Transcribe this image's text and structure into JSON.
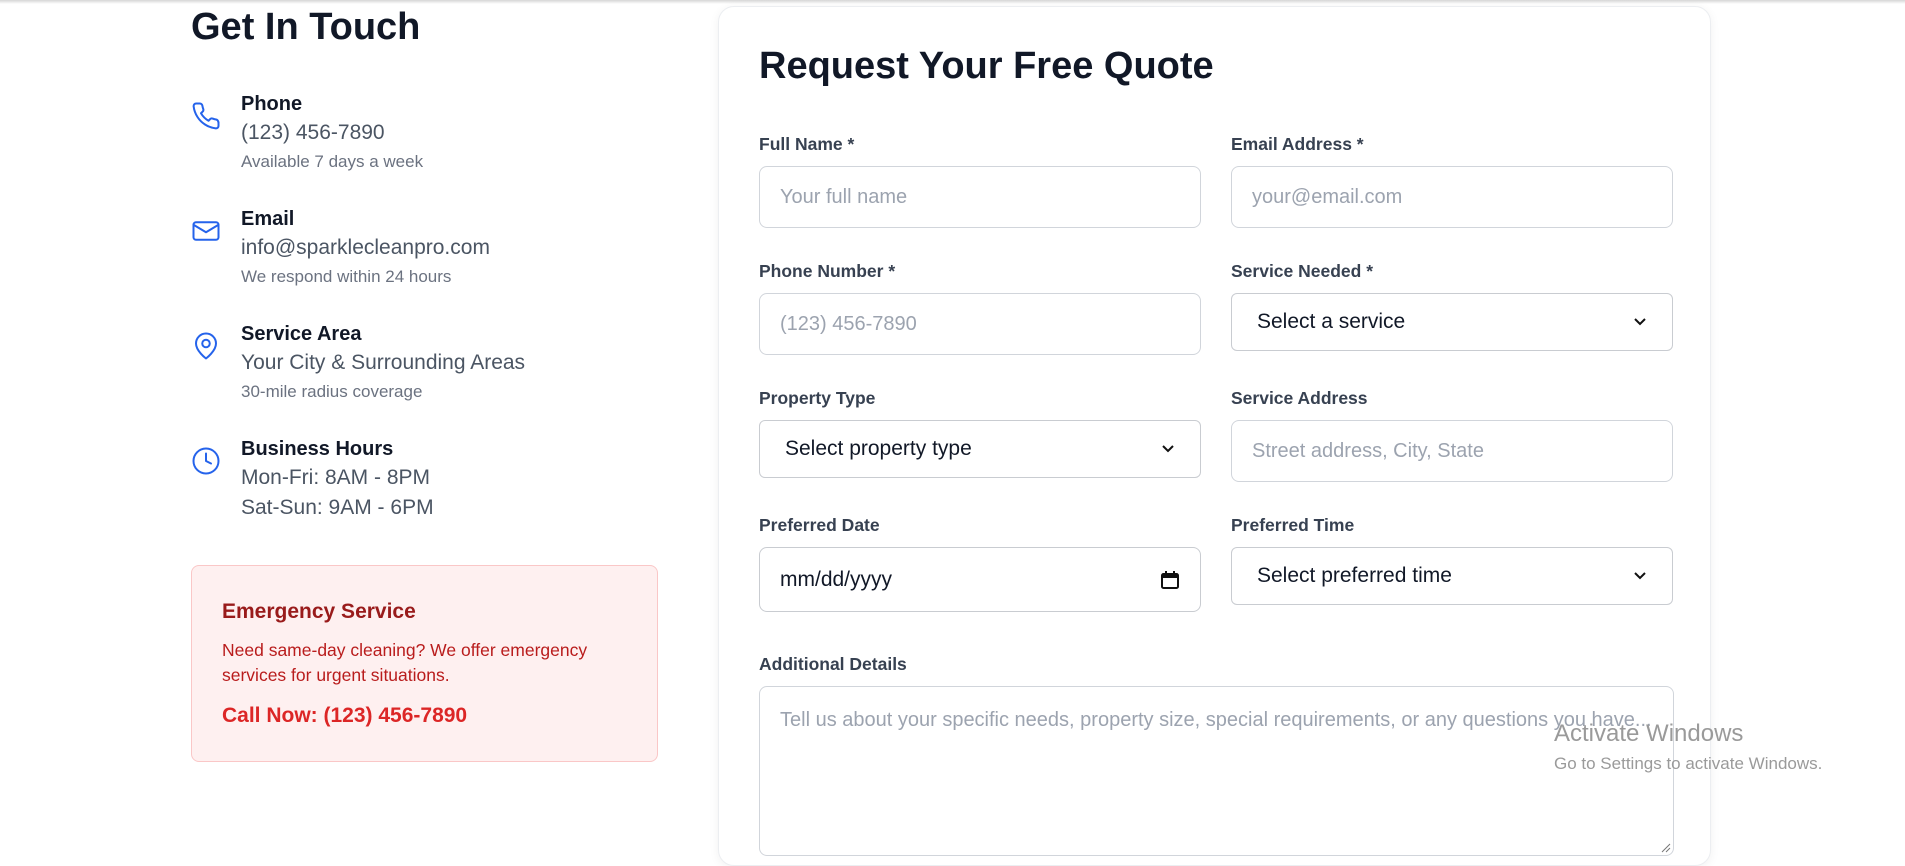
{
  "contact": {
    "title": "Get In Touch",
    "phone": {
      "label": "Phone",
      "value": "(123) 456-7890",
      "note": "Available 7 days a week",
      "icon": "phone-icon"
    },
    "email": {
      "label": "Email",
      "value": "info@sparklecleanpro.com",
      "note": "We respond within 24 hours",
      "icon": "mail-icon"
    },
    "area": {
      "label": "Service Area",
      "value": "Your City & Surrounding Areas",
      "note": "30-mile radius coverage",
      "icon": "map-pin-icon"
    },
    "hours": {
      "label": "Business Hours",
      "line1": "Mon-Fri: 8AM - 8PM",
      "line2": "Sat-Sun: 9AM - 6PM",
      "icon": "clock-icon"
    },
    "emergency": {
      "title": "Emergency Service",
      "text": "Need same-day cleaning? We offer emergency services for urgent situations.",
      "call": "Call Now: (123) 456-7890"
    }
  },
  "form": {
    "title": "Request Your Free Quote",
    "full_name": {
      "label": "Full Name *",
      "placeholder": "Your full name",
      "value": ""
    },
    "email": {
      "label": "Email Address *",
      "placeholder": "your@email.com",
      "value": ""
    },
    "phone": {
      "label": "Phone Number *",
      "placeholder": "(123) 456-7890",
      "value": ""
    },
    "service": {
      "label": "Service Needed *",
      "selected": "Select a service"
    },
    "property_type": {
      "label": "Property Type",
      "selected": "Select property type"
    },
    "address": {
      "label": "Service Address",
      "placeholder": "Street address, City, State",
      "value": ""
    },
    "date": {
      "label": "Preferred Date",
      "value": "mm/dd/yyyy"
    },
    "time": {
      "label": "Preferred Time",
      "selected": "Select preferred time"
    },
    "details": {
      "label": "Additional Details",
      "placeholder": "Tell us about your specific needs, property size, special requirements, or any questions you have..."
    }
  },
  "watermark": {
    "title": "Activate Windows",
    "subtitle": "Go to Settings to activate Windows."
  },
  "colors": {
    "accent_icon": "#2563eb",
    "emergency_bg": "#fef0f0",
    "emergency_text": "#b91c1c"
  }
}
